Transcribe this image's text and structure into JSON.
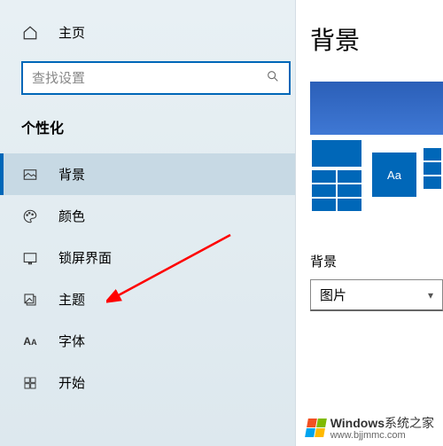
{
  "sidebar": {
    "home_label": "主页",
    "search_placeholder": "查找设置",
    "section_title": "个性化",
    "items": [
      {
        "label": "背景"
      },
      {
        "label": "颜色"
      },
      {
        "label": "锁屏界面"
      },
      {
        "label": "主题"
      },
      {
        "label": "字体"
      },
      {
        "label": "开始"
      }
    ]
  },
  "main": {
    "title": "背景",
    "preview_tile_text": "Aa",
    "sub_label": "背景",
    "dropdown_value": "图片"
  },
  "watermark": {
    "brand": "Windows",
    "text1": "系统之家",
    "url": "www.bjjmmc.com"
  }
}
